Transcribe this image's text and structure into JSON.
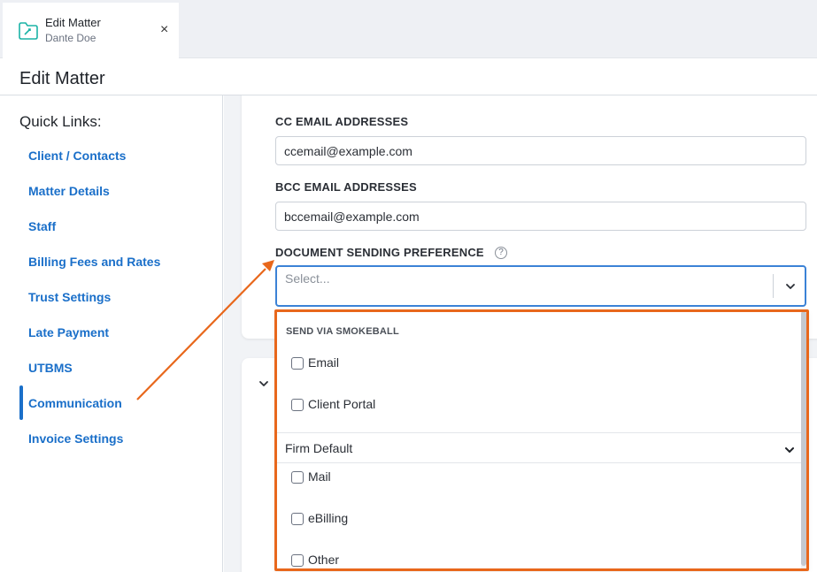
{
  "tab": {
    "title": "Edit Matter",
    "subtitle": "Dante Doe",
    "close": "×"
  },
  "page": {
    "title": "Edit Matter"
  },
  "sidebar": {
    "title": "Quick Links:",
    "items": [
      {
        "label": "Client / Contacts"
      },
      {
        "label": "Matter Details"
      },
      {
        "label": "Staff"
      },
      {
        "label": "Billing Fees and Rates"
      },
      {
        "label": "Trust Settings"
      },
      {
        "label": "Late Payment"
      },
      {
        "label": "UTBMS"
      },
      {
        "label": "Communication",
        "active": true
      },
      {
        "label": "Invoice Settings"
      }
    ]
  },
  "form": {
    "cc": {
      "label": "CC EMAIL ADDRESSES",
      "value": "ccemail@example.com"
    },
    "bcc": {
      "label": "BCC EMAIL ADDRESSES",
      "value": "bccemail@example.com"
    },
    "doc_pref": {
      "label": "DOCUMENT SENDING PREFERENCE",
      "help": "?",
      "placeholder": "Select..."
    }
  },
  "dropdown": {
    "group_label": "SEND VIA SMOKEBALL",
    "options": [
      {
        "label": "Email",
        "checked": false
      },
      {
        "label": "Client Portal",
        "checked": false
      }
    ],
    "firm_default": "Firm Default",
    "more_options": [
      {
        "label": "Mail",
        "checked": false
      },
      {
        "label": "eBilling",
        "checked": false
      },
      {
        "label": "Other",
        "checked": false
      }
    ]
  },
  "colors": {
    "link": "#1a6fc9",
    "focus": "#3b82d6",
    "annotation": "#e8671b",
    "brand_icon": "#1bb3a6"
  },
  "icons": {
    "tab": "folder-icon",
    "close": "close-icon",
    "help": "question-circle-icon",
    "chevron": "chevron-down-icon"
  }
}
